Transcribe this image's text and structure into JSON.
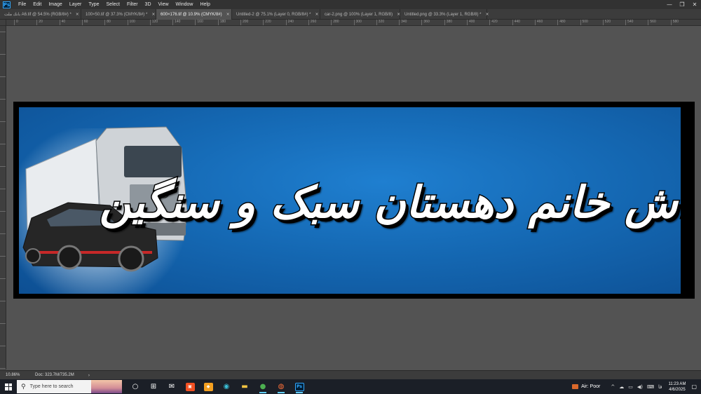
{
  "app": {
    "logo": "Ps",
    "menu": [
      "File",
      "Edit",
      "Image",
      "Layer",
      "Type",
      "Select",
      "Filter",
      "3D",
      "View",
      "Window",
      "Help"
    ],
    "window_controls": [
      "—",
      "❐",
      "✕"
    ]
  },
  "tabs": [
    {
      "label": "A6.tif @ 54.5% (RGB/8#) *",
      "prefix": "بانك ملت",
      "active": false
    },
    {
      "label": "100×50.tif @ 37.3% (CMYK/8#) *",
      "active": false
    },
    {
      "label": "600×176.tif @ 10.9% (CMYK/8#)",
      "active": true
    },
    {
      "label": "Untitled-2 @ 75.1% (Layer 0, RGB/8#) *",
      "active": false
    },
    {
      "label": "car-2.png @ 100% (Layer 1, RGB/8)",
      "active": false
    },
    {
      "label": "Untitled.png @ 33.3% (Layer 1, RGB/8) *",
      "active": false
    }
  ],
  "tab_close": "×",
  "ruler": {
    "top_labels": [
      "0",
      "20",
      "40",
      "60",
      "80",
      "100",
      "120",
      "140",
      "160",
      "180",
      "200",
      "220",
      "240",
      "260",
      "280",
      "300",
      "320",
      "340",
      "360",
      "380",
      "400",
      "420",
      "440",
      "460",
      "480",
      "500",
      "520",
      "540",
      "560",
      "580"
    ]
  },
  "banner": {
    "title": "کارواش خانم دهستان سبک و سنگین",
    "bg_color": "#1569b4",
    "border_color": "#000000"
  },
  "statusbar": {
    "zoom": "10.86%",
    "doc": "Doc: 323.7M/735.2M",
    "arrow": "›"
  },
  "taskbar": {
    "search_icon": "search-icon",
    "search_placeholder": "Type here to search",
    "icons": [
      {
        "name": "task-view-icon",
        "glyph": "○"
      },
      {
        "name": "widgets-icon",
        "glyph": "⊞"
      },
      {
        "name": "mail-icon",
        "glyph": "✉"
      },
      {
        "name": "store-icon",
        "glyph": "▣"
      },
      {
        "name": "files-app-icon",
        "glyph": "◆"
      },
      {
        "name": "edge-icon",
        "glyph": "◉"
      },
      {
        "name": "file-explorer-icon",
        "glyph": "▬"
      },
      {
        "name": "chrome-icon",
        "glyph": "●"
      },
      {
        "name": "firefox-icon",
        "glyph": "◍"
      },
      {
        "name": "photoshop-icon",
        "glyph": "Ps"
      }
    ],
    "weather_text": "Air: Poor",
    "time": "11:23 AM",
    "date": "4/6/2025",
    "tray_symbols": [
      "^",
      "☁",
      "▭",
      "◀)",
      "⌨"
    ],
    "lang": "فا",
    "notification_icon": "▢"
  }
}
